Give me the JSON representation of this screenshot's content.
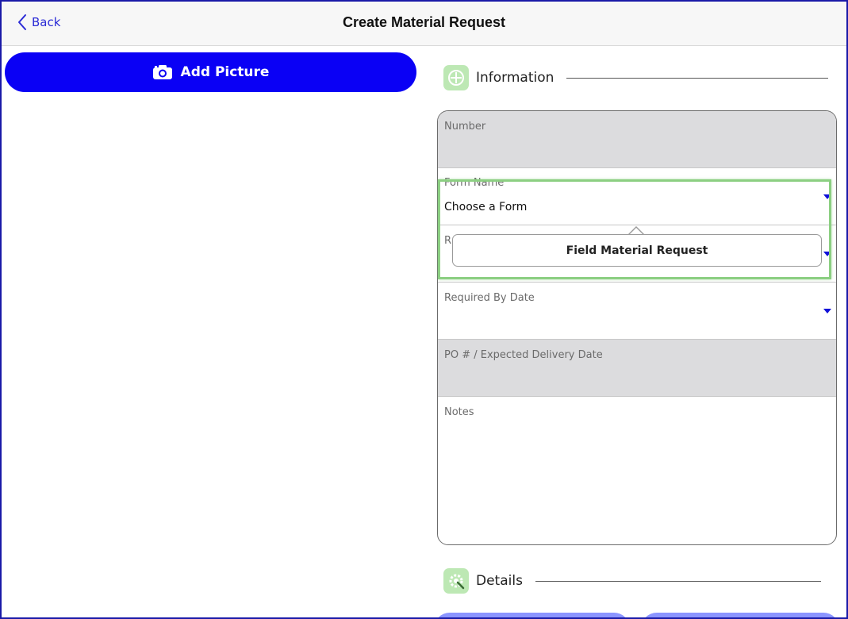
{
  "nav": {
    "back_label": "Back",
    "title": "Create Material Request"
  },
  "add_picture": {
    "label": "Add Picture"
  },
  "sections": {
    "information": "Information",
    "details": "Details"
  },
  "form": {
    "number_label": "Number",
    "form_name_label": "Form Name",
    "form_name_value": "Choose a Form",
    "requested_label": "R",
    "required_by_label": "Required By Date",
    "po_label": "PO # / Expected Delivery Date",
    "notes_label": "Notes"
  },
  "popover": {
    "option": "Field Material Request"
  },
  "colors": {
    "accent": "#0a00f5",
    "link": "#2b2bd6",
    "section_icon_bg": "#bde8b4",
    "highlight": "#8ccf82"
  }
}
